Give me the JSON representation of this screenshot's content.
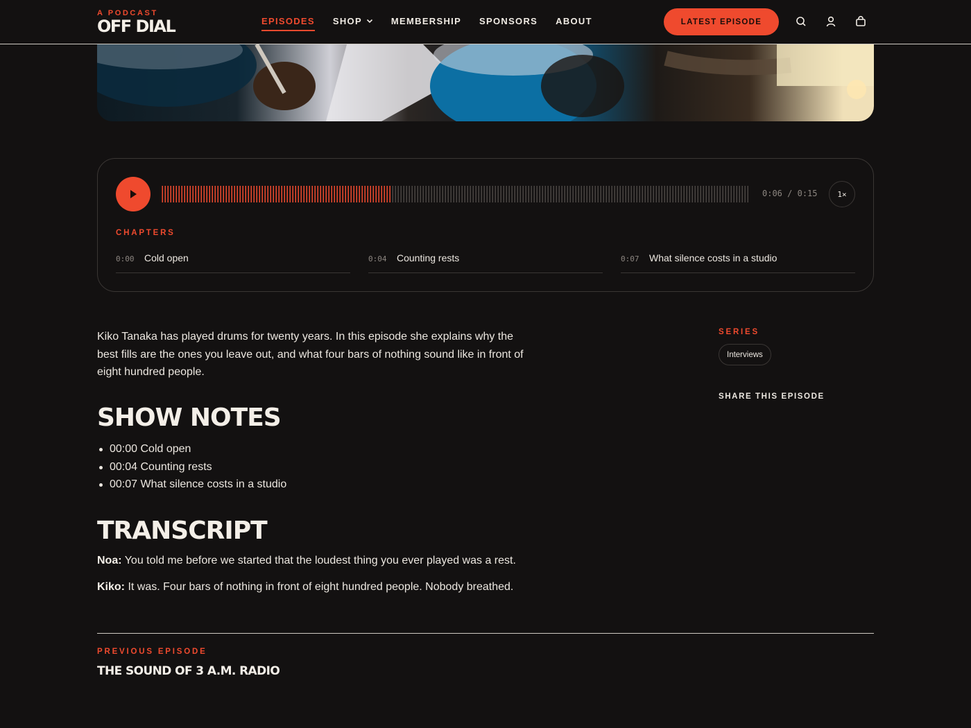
{
  "brand": {
    "kicker": "A PODCAST",
    "name": "OFF DIAL"
  },
  "nav": {
    "items": [
      {
        "label": "EPISODES",
        "active": true
      },
      {
        "label": "SHOP",
        "has_dropdown": true
      },
      {
        "label": "MEMBERSHIP"
      },
      {
        "label": "SPONSORS"
      },
      {
        "label": "ABOUT"
      }
    ],
    "cta_label": "LATEST EPISODE",
    "icons": [
      "search-icon",
      "account-icon",
      "bag-icon"
    ]
  },
  "player": {
    "elapsed": "0:06",
    "separator": "/",
    "duration": "0:15",
    "progress": 0.39,
    "speed": "1×",
    "chapters_label": "CHAPTERS",
    "chapters": [
      {
        "time": "0:00",
        "title": "Cold open"
      },
      {
        "time": "0:04",
        "title": "Counting rests"
      },
      {
        "time": "0:07",
        "title": "What silence costs in a studio"
      }
    ]
  },
  "intro": "Kiko Tanaka has played drums for twenty years. In this episode she explains why the best fills are the ones you leave out, and what four bars of nothing sound like in front of eight hundred people.",
  "show_notes": {
    "heading": "SHOW NOTES",
    "items": [
      "00:00 Cold open",
      "00:04 Counting rests",
      "00:07 What silence costs in a studio"
    ]
  },
  "transcript": {
    "heading": "TRANSCRIPT",
    "lines": [
      {
        "speaker": "Noa:",
        "text": "You told me before we started that the loudest thing you ever played was a rest."
      },
      {
        "speaker": "Kiko:",
        "text": "It was. Four bars of nothing in front of eight hundred people. Nobody breathed."
      }
    ]
  },
  "sidebar": {
    "series_label": "SERIES",
    "series_tag": "Interviews",
    "share_label": "SHARE THIS EPISODE"
  },
  "footer_nav": {
    "prev_label": "PREVIOUS EPISODE",
    "prev_title": "THE SOUND OF 3 A.M. RADIO"
  },
  "colors": {
    "accent": "#ef4a2e",
    "background": "#131111",
    "text": "#ece7e0",
    "muted": "#8c8680",
    "border": "#3a3634"
  }
}
